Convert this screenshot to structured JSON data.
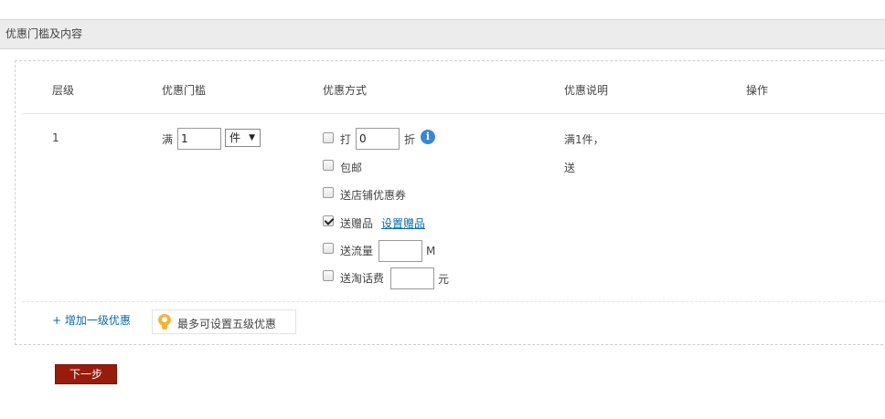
{
  "section": {
    "title": "优惠门槛及内容"
  },
  "table": {
    "headers": [
      "层级",
      "优惠门槛",
      "优惠方式",
      "优惠说明",
      "操作"
    ],
    "row": {
      "level": "1",
      "threshold": {
        "prefix": "满",
        "value": "1",
        "unit": "件"
      },
      "methods": {
        "discount": {
          "label": "打",
          "value": "0",
          "suffix": "折",
          "checked": false
        },
        "free_shipping": {
          "label": "包邮",
          "checked": false
        },
        "coupon": {
          "label": "送店铺优惠券",
          "checked": false
        },
        "gift": {
          "label": "送赠品",
          "link": "设置赠品",
          "checked": true
        },
        "traffic": {
          "label": "送流量",
          "value": "",
          "suffix": "M",
          "checked": false
        },
        "phone_fee": {
          "label": "送淘话费",
          "value": "",
          "suffix": "元",
          "checked": false
        }
      },
      "description": [
        "满1件，",
        "送"
      ]
    }
  },
  "add_level": "+ 增加一级优惠",
  "tip": "最多可设置五级优惠",
  "next_button": "下一步",
  "colors": {
    "link": "#0a6aa8",
    "primary_button": "#991b0b",
    "info_icon": "#3a86d4",
    "tip_icon": "#f5b335"
  }
}
